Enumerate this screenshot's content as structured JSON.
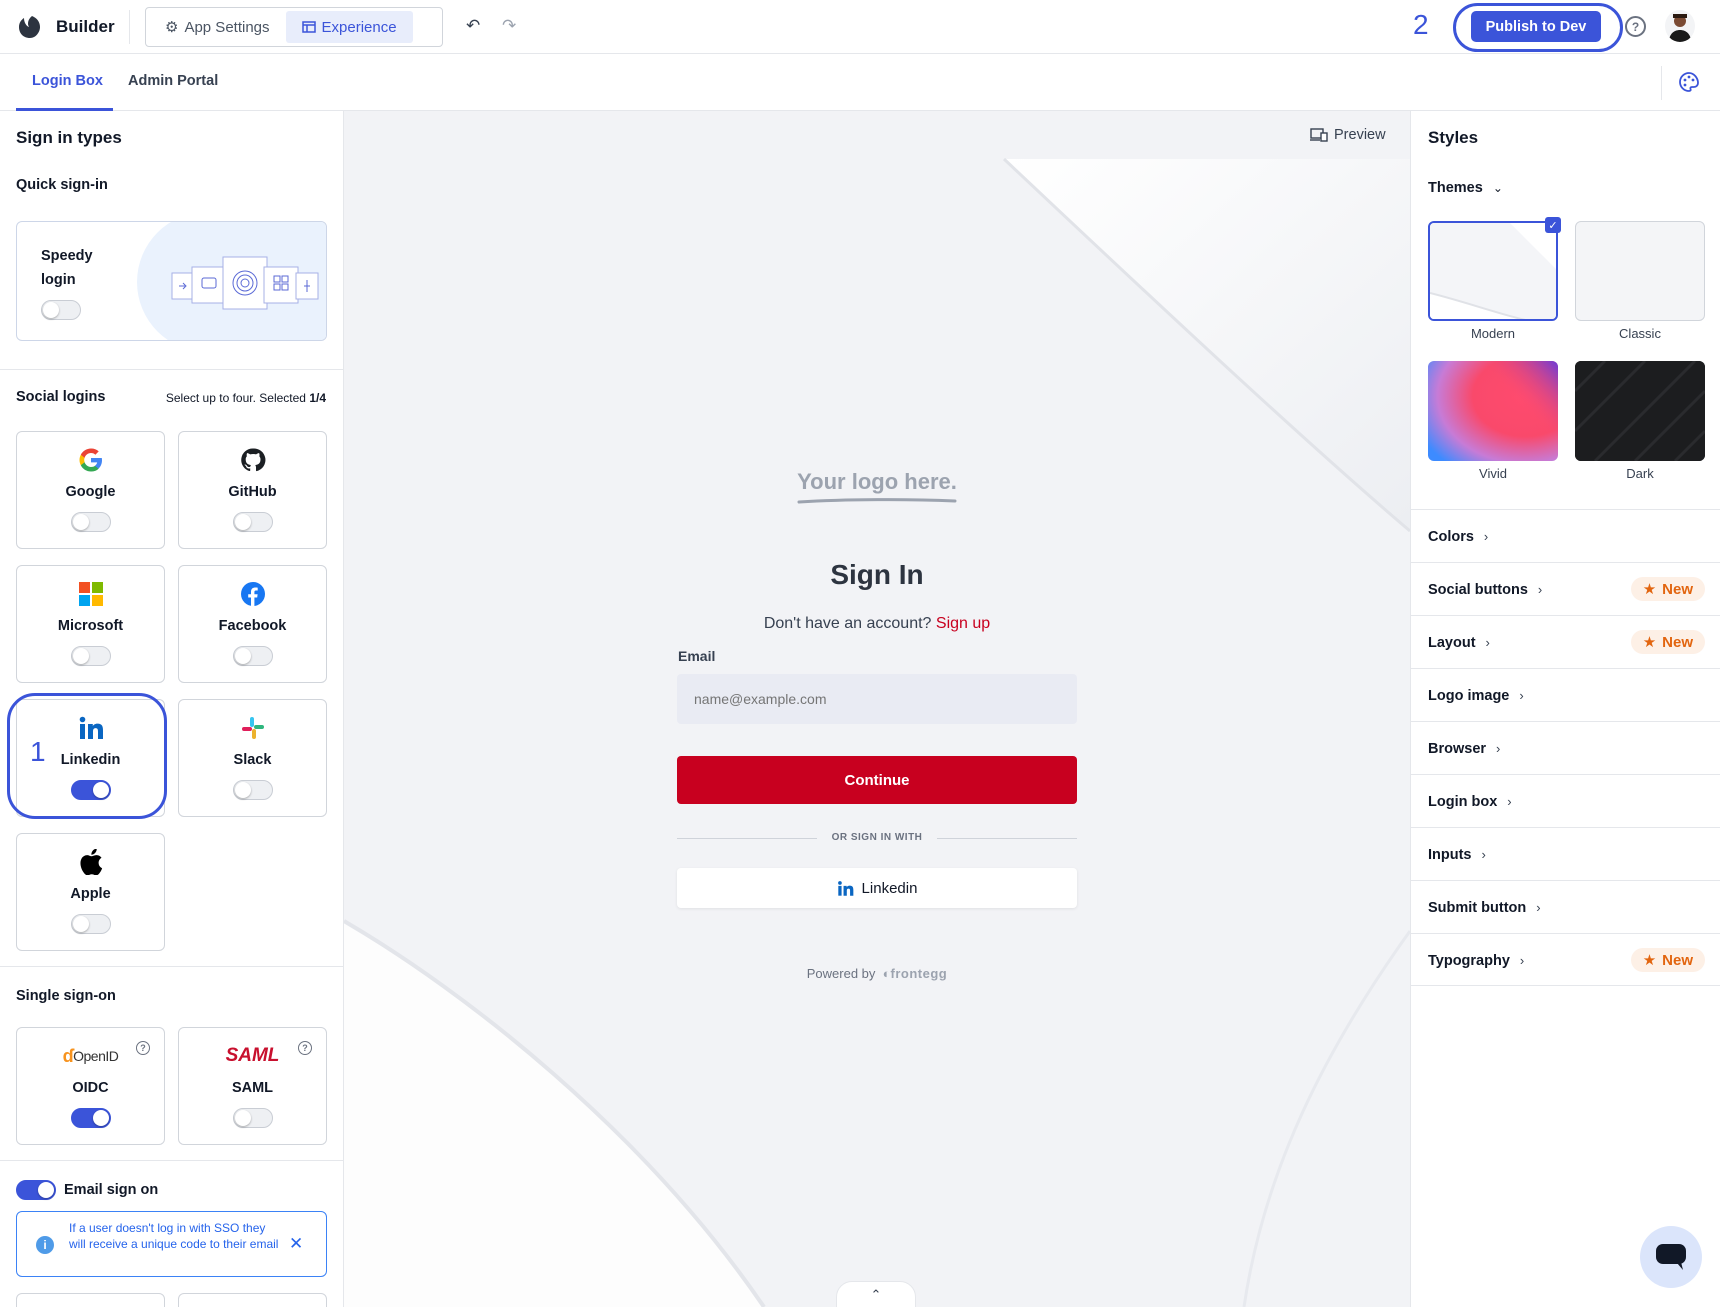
{
  "topbar": {
    "brand": "Builder",
    "tabs": [
      {
        "label": "App Settings",
        "icon": "gear-icon"
      },
      {
        "label": "Experience",
        "icon": "layout-icon"
      }
    ],
    "step_2": "2",
    "publish_label": "Publish to Dev",
    "help_label": "?"
  },
  "tabs": [
    {
      "label": "Login Box"
    },
    {
      "label": "Admin Portal"
    }
  ],
  "left": {
    "title": "Sign in types",
    "quick": {
      "title": "Quick sign-in",
      "speedy_label": "Speedy login"
    },
    "social": {
      "title": "Social logins",
      "hint_prefix": "Select up to four. Selected ",
      "hint_count": "1/4",
      "step_1": "1",
      "items": [
        {
          "label": "Google",
          "icon": "google-icon",
          "enabled": false
        },
        {
          "label": "GitHub",
          "icon": "github-icon",
          "enabled": false
        },
        {
          "label": "Microsoft",
          "icon": "microsoft-icon",
          "enabled": false
        },
        {
          "label": "Facebook",
          "icon": "facebook-icon",
          "enabled": false
        },
        {
          "label": "Linkedin",
          "icon": "linkedin-icon",
          "enabled": true
        },
        {
          "label": "Slack",
          "icon": "slack-icon",
          "enabled": false
        },
        {
          "label": "Apple",
          "icon": "apple-icon",
          "enabled": false
        }
      ]
    },
    "sso": {
      "title": "Single sign-on",
      "items": [
        {
          "label": "OIDC",
          "logo": "OpenID",
          "enabled": true
        },
        {
          "label": "SAML",
          "logo": "SAML",
          "enabled": false
        }
      ]
    },
    "email": {
      "label": "Email sign on",
      "info": "If a user doesn't log in with SSO they will receive a unique code to their email"
    }
  },
  "preview": {
    "button": "Preview",
    "logo_placeholder": "Your logo here.",
    "title": "Sign In",
    "signup_prompt": "Don't have an account?",
    "signup_link": "Sign up",
    "email_label": "Email",
    "email_placeholder": "name@example.com",
    "continue": "Continue",
    "divider": "OR SIGN IN WITH",
    "social_button": "Linkedin",
    "powered_by": "Powered by",
    "powered_brand": "frontegg",
    "collapse": "⌃"
  },
  "styles": {
    "title": "Styles",
    "themes_label": "Themes",
    "themes": [
      {
        "label": "Modern",
        "selected": true
      },
      {
        "label": "Classic",
        "selected": false
      },
      {
        "label": "Vivid",
        "selected": false
      },
      {
        "label": "Dark",
        "selected": false
      }
    ],
    "sections": [
      {
        "label": "Colors",
        "badge": ""
      },
      {
        "label": "Social buttons",
        "badge": "New"
      },
      {
        "label": "Layout",
        "badge": "New"
      },
      {
        "label": "Logo image",
        "badge": ""
      },
      {
        "label": "Browser",
        "badge": ""
      },
      {
        "label": "Login box",
        "badge": ""
      },
      {
        "label": "Inputs",
        "badge": ""
      },
      {
        "label": "Submit button",
        "badge": ""
      },
      {
        "label": "Typography",
        "badge": "New"
      }
    ]
  },
  "colors": {
    "accent": "#3b54d9",
    "brand_red": "#c8001f",
    "new_badge": "#e2650f"
  }
}
